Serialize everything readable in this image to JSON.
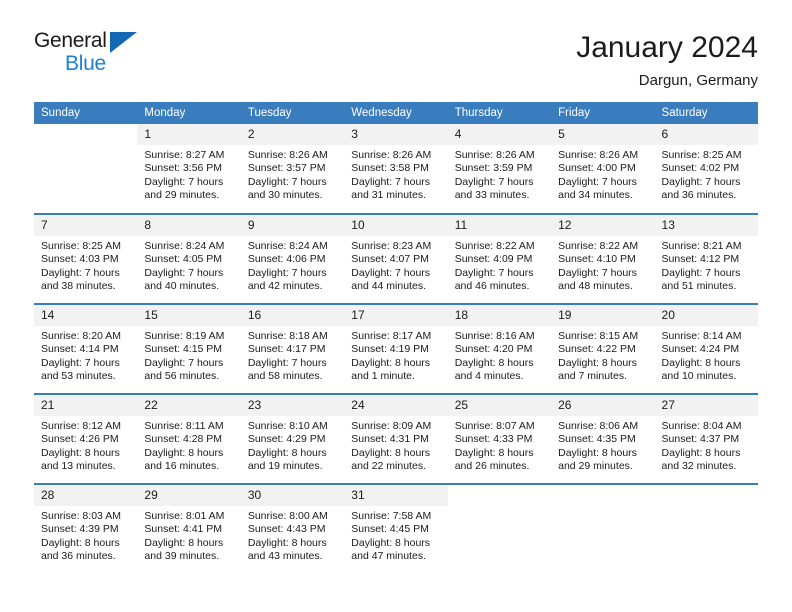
{
  "brand": {
    "name_part1": "General",
    "name_part2": "Blue",
    "triangle_color": "#1268b3",
    "blue_color": "#1c7fd4"
  },
  "header": {
    "title": "January 2024",
    "subtitle": "Dargun, Germany"
  },
  "theme": {
    "header_bg": "#3a7dbf",
    "header_text": "#ffffff",
    "daynum_bg": "#f2f2f2",
    "divider": "#3a7dbf"
  },
  "calendar": {
    "weekdays": [
      "Sunday",
      "Monday",
      "Tuesday",
      "Wednesday",
      "Thursday",
      "Friday",
      "Saturday"
    ],
    "weeks": [
      [
        {
          "day": "",
          "lines": []
        },
        {
          "day": "1",
          "lines": [
            "Sunrise: 8:27 AM",
            "Sunset: 3:56 PM",
            "Daylight: 7 hours",
            "and 29 minutes."
          ]
        },
        {
          "day": "2",
          "lines": [
            "Sunrise: 8:26 AM",
            "Sunset: 3:57 PM",
            "Daylight: 7 hours",
            "and 30 minutes."
          ]
        },
        {
          "day": "3",
          "lines": [
            "Sunrise: 8:26 AM",
            "Sunset: 3:58 PM",
            "Daylight: 7 hours",
            "and 31 minutes."
          ]
        },
        {
          "day": "4",
          "lines": [
            "Sunrise: 8:26 AM",
            "Sunset: 3:59 PM",
            "Daylight: 7 hours",
            "and 33 minutes."
          ]
        },
        {
          "day": "5",
          "lines": [
            "Sunrise: 8:26 AM",
            "Sunset: 4:00 PM",
            "Daylight: 7 hours",
            "and 34 minutes."
          ]
        },
        {
          "day": "6",
          "lines": [
            "Sunrise: 8:25 AM",
            "Sunset: 4:02 PM",
            "Daylight: 7 hours",
            "and 36 minutes."
          ]
        }
      ],
      [
        {
          "day": "7",
          "lines": [
            "Sunrise: 8:25 AM",
            "Sunset: 4:03 PM",
            "Daylight: 7 hours",
            "and 38 minutes."
          ]
        },
        {
          "day": "8",
          "lines": [
            "Sunrise: 8:24 AM",
            "Sunset: 4:05 PM",
            "Daylight: 7 hours",
            "and 40 minutes."
          ]
        },
        {
          "day": "9",
          "lines": [
            "Sunrise: 8:24 AM",
            "Sunset: 4:06 PM",
            "Daylight: 7 hours",
            "and 42 minutes."
          ]
        },
        {
          "day": "10",
          "lines": [
            "Sunrise: 8:23 AM",
            "Sunset: 4:07 PM",
            "Daylight: 7 hours",
            "and 44 minutes."
          ]
        },
        {
          "day": "11",
          "lines": [
            "Sunrise: 8:22 AM",
            "Sunset: 4:09 PM",
            "Daylight: 7 hours",
            "and 46 minutes."
          ]
        },
        {
          "day": "12",
          "lines": [
            "Sunrise: 8:22 AM",
            "Sunset: 4:10 PM",
            "Daylight: 7 hours",
            "and 48 minutes."
          ]
        },
        {
          "day": "13",
          "lines": [
            "Sunrise: 8:21 AM",
            "Sunset: 4:12 PM",
            "Daylight: 7 hours",
            "and 51 minutes."
          ]
        }
      ],
      [
        {
          "day": "14",
          "lines": [
            "Sunrise: 8:20 AM",
            "Sunset: 4:14 PM",
            "Daylight: 7 hours",
            "and 53 minutes."
          ]
        },
        {
          "day": "15",
          "lines": [
            "Sunrise: 8:19 AM",
            "Sunset: 4:15 PM",
            "Daylight: 7 hours",
            "and 56 minutes."
          ]
        },
        {
          "day": "16",
          "lines": [
            "Sunrise: 8:18 AM",
            "Sunset: 4:17 PM",
            "Daylight: 7 hours",
            "and 58 minutes."
          ]
        },
        {
          "day": "17",
          "lines": [
            "Sunrise: 8:17 AM",
            "Sunset: 4:19 PM",
            "Daylight: 8 hours",
            "and 1 minute."
          ]
        },
        {
          "day": "18",
          "lines": [
            "Sunrise: 8:16 AM",
            "Sunset: 4:20 PM",
            "Daylight: 8 hours",
            "and 4 minutes."
          ]
        },
        {
          "day": "19",
          "lines": [
            "Sunrise: 8:15 AM",
            "Sunset: 4:22 PM",
            "Daylight: 8 hours",
            "and 7 minutes."
          ]
        },
        {
          "day": "20",
          "lines": [
            "Sunrise: 8:14 AM",
            "Sunset: 4:24 PM",
            "Daylight: 8 hours",
            "and 10 minutes."
          ]
        }
      ],
      [
        {
          "day": "21",
          "lines": [
            "Sunrise: 8:12 AM",
            "Sunset: 4:26 PM",
            "Daylight: 8 hours",
            "and 13 minutes."
          ]
        },
        {
          "day": "22",
          "lines": [
            "Sunrise: 8:11 AM",
            "Sunset: 4:28 PM",
            "Daylight: 8 hours",
            "and 16 minutes."
          ]
        },
        {
          "day": "23",
          "lines": [
            "Sunrise: 8:10 AM",
            "Sunset: 4:29 PM",
            "Daylight: 8 hours",
            "and 19 minutes."
          ]
        },
        {
          "day": "24",
          "lines": [
            "Sunrise: 8:09 AM",
            "Sunset: 4:31 PM",
            "Daylight: 8 hours",
            "and 22 minutes."
          ]
        },
        {
          "day": "25",
          "lines": [
            "Sunrise: 8:07 AM",
            "Sunset: 4:33 PM",
            "Daylight: 8 hours",
            "and 26 minutes."
          ]
        },
        {
          "day": "26",
          "lines": [
            "Sunrise: 8:06 AM",
            "Sunset: 4:35 PM",
            "Daylight: 8 hours",
            "and 29 minutes."
          ]
        },
        {
          "day": "27",
          "lines": [
            "Sunrise: 8:04 AM",
            "Sunset: 4:37 PM",
            "Daylight: 8 hours",
            "and 32 minutes."
          ]
        }
      ],
      [
        {
          "day": "28",
          "lines": [
            "Sunrise: 8:03 AM",
            "Sunset: 4:39 PM",
            "Daylight: 8 hours",
            "and 36 minutes."
          ]
        },
        {
          "day": "29",
          "lines": [
            "Sunrise: 8:01 AM",
            "Sunset: 4:41 PM",
            "Daylight: 8 hours",
            "and 39 minutes."
          ]
        },
        {
          "day": "30",
          "lines": [
            "Sunrise: 8:00 AM",
            "Sunset: 4:43 PM",
            "Daylight: 8 hours",
            "and 43 minutes."
          ]
        },
        {
          "day": "31",
          "lines": [
            "Sunrise: 7:58 AM",
            "Sunset: 4:45 PM",
            "Daylight: 8 hours",
            "and 47 minutes."
          ]
        },
        {
          "day": "",
          "lines": []
        },
        {
          "day": "",
          "lines": []
        },
        {
          "day": "",
          "lines": []
        }
      ]
    ]
  }
}
